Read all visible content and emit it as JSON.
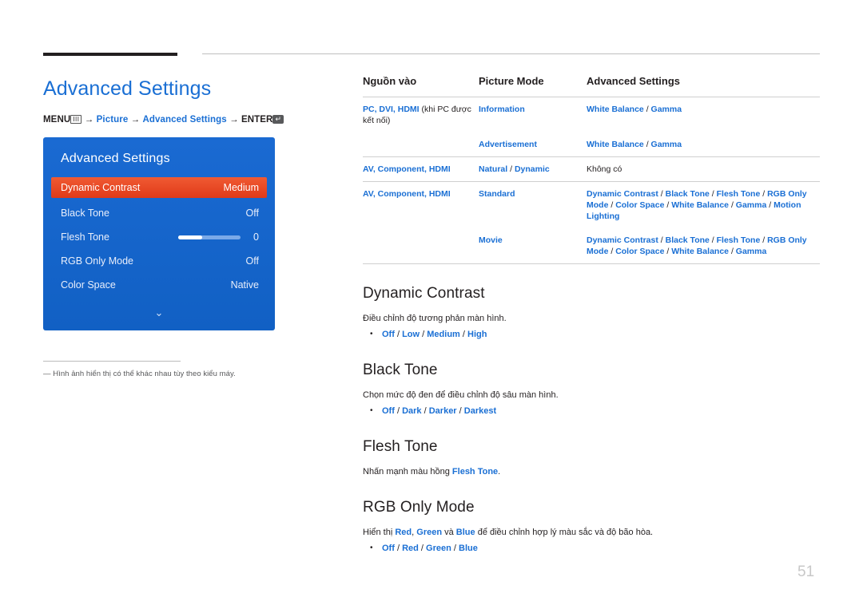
{
  "page_number": "51",
  "header": {
    "title": "Advanced Settings",
    "menu_path": {
      "menu_label": "MENU",
      "menu_glyph": "III",
      "arrow": "→",
      "item1": "Picture",
      "item2": "Advanced Settings",
      "enter_label": "ENTER",
      "enter_glyph": "↵"
    }
  },
  "osd": {
    "title": "Advanced Settings",
    "rows": [
      {
        "label": "Dynamic Contrast",
        "value": "Medium",
        "highlight": true
      },
      {
        "label": "Black Tone",
        "value": "Off",
        "highlight": false
      },
      {
        "label": "Flesh Tone",
        "value": "0",
        "highlight": false,
        "slider": true
      },
      {
        "label": "RGB Only Mode",
        "value": "Off",
        "highlight": false
      },
      {
        "label": "Color Space",
        "value": "Native",
        "highlight": false
      }
    ],
    "scroll_arrow": "⌄"
  },
  "figure_note": "―  Hình ảnh hiển thị có thể khác nhau tùy theo kiểu máy.",
  "table": {
    "headers": [
      "Nguồn vào",
      "Picture Mode",
      "Advanced Settings"
    ],
    "rows": [
      {
        "source_blue": "PC, DVI, HDMI",
        "source_plain": " (khi PC được kết nối)",
        "mode": "Information",
        "settings": "White Balance / Gamma"
      },
      {
        "source_blue": "",
        "source_plain": "",
        "mode": "Advertisement",
        "settings": "White Balance / Gamma"
      },
      {
        "source_blue": "AV, Component, HDMI",
        "source_plain": "",
        "mode": "Natural / Dynamic",
        "settings": "Không có"
      },
      {
        "source_blue": "AV, Component, HDMI",
        "source_plain": "",
        "mode": "Standard",
        "settings": "Dynamic Contrast / Black Tone / Flesh Tone / RGB Only Mode / Color Space / White Balance / Gamma / Motion Lighting"
      },
      {
        "source_blue": "",
        "source_plain": "",
        "mode": "Movie",
        "settings": "Dynamic Contrast / Black Tone / Flesh Tone / RGB Only Mode / Color Space / White Balance / Gamma"
      }
    ]
  },
  "sections": [
    {
      "title": "Dynamic Contrast",
      "desc": "Điều chỉnh độ tương phản màn hình.",
      "options": "Off / Low / Medium / High"
    },
    {
      "title": "Black Tone",
      "desc": "Chọn mức độ đen để điều chỉnh độ sâu màn hình.",
      "options": "Off / Dark / Darker / Darkest"
    },
    {
      "title": "Flesh Tone",
      "desc_pre": "Nhấn mạnh màu hồng ",
      "desc_blue": "Flesh Tone",
      "desc_post": ".",
      "options": ""
    },
    {
      "title": "RGB Only Mode",
      "desc_pre": "Hiển thị ",
      "desc_blue1": "Red",
      "desc_mid1": ", ",
      "desc_blue2": "Green",
      "desc_mid2": " và ",
      "desc_blue3": "Blue",
      "desc_post": " để điều chỉnh hợp lý màu sắc và độ bão hòa.",
      "options": "Off / Red / Green / Blue"
    }
  ],
  "colors": {
    "accent_blue": "#1a6fd4",
    "osd_blue": "#1464c8",
    "highlight_orange": "#e8452c"
  }
}
